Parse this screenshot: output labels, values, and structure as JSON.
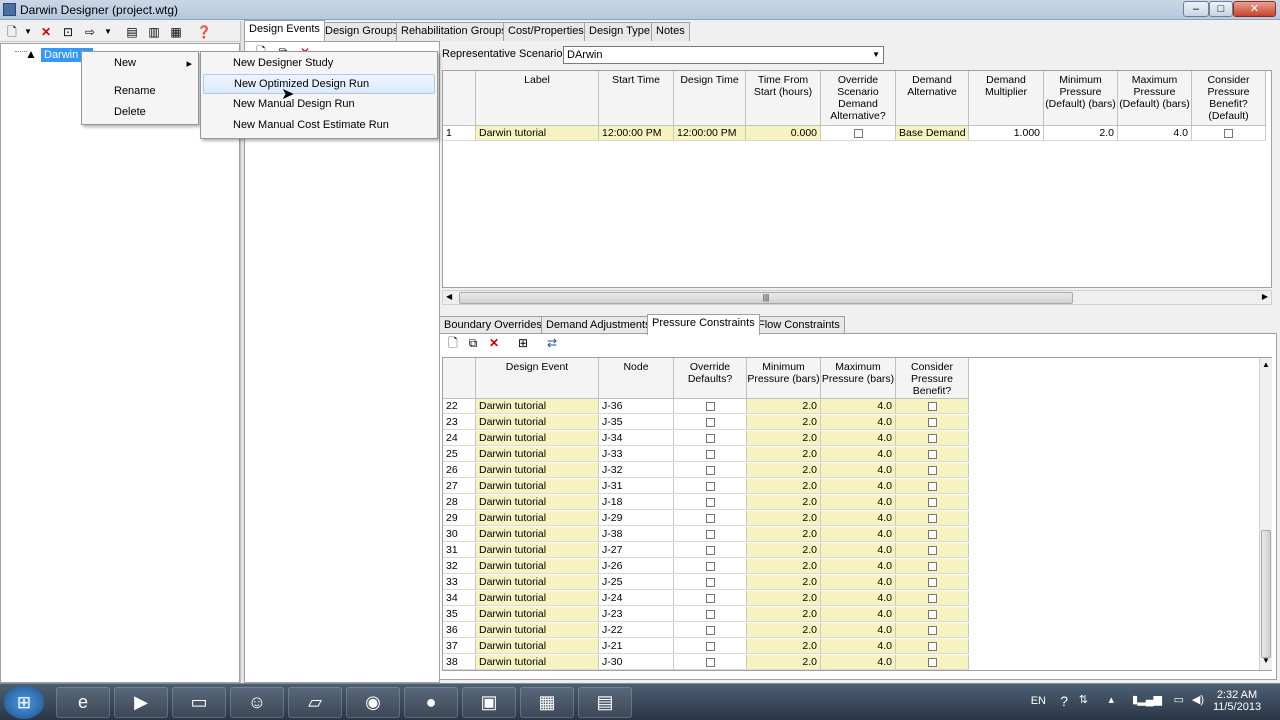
{
  "window": {
    "title": "Darwin Designer (project.wtg)",
    "buttons": {
      "minimize": "–",
      "maximize": "□",
      "close": "✕"
    }
  },
  "tree": {
    "node_label": "Darwin tu"
  },
  "context_menu": {
    "items": [
      "New",
      "Rename",
      "Delete"
    ],
    "submenu": [
      "New Designer Study",
      "New Optimized Design Run",
      "New Manual Design Run",
      "New Manual Cost Estimate Run"
    ],
    "arrow": "▸"
  },
  "top_tabs": [
    "Design Events",
    "Design Groups",
    "Rehabilitation Groups",
    "Cost/Properties",
    "Design Type",
    "Notes"
  ],
  "scenario": {
    "label": "Representative Scenario:",
    "value": "DArwin"
  },
  "grid1": {
    "headers": [
      "Label",
      "Start Time",
      "Design Time",
      "Time From Start (hours)",
      "Override Scenario Demand Alternative?",
      "Demand Alternative",
      "Demand Multiplier",
      "Minimum Pressure (Default) (bars)",
      "Maximum Pressure (Default) (bars)",
      "Consider Pressure Benefit? (Default)"
    ],
    "row": {
      "num": "1",
      "label": "Darwin tutorial",
      "start": "12:00:00 PM",
      "design": "12:00:00 PM",
      "tfs": "0.000",
      "demand_alt": "Base Demand",
      "mult": "1.000",
      "minp": "2.0",
      "maxp": "4.0"
    }
  },
  "bottom_tabs": [
    "Boundary Overrides",
    "Demand Adjustments",
    "Pressure Constraints",
    "Flow Constraints"
  ],
  "grid2": {
    "headers": [
      "Design Event",
      "Node",
      "Override Defaults?",
      "Minimum Pressure (bars)",
      "Maximum Pressure (bars)",
      "Consider Pressure Benefit?"
    ],
    "rows": [
      [
        "22",
        "Darwin tutorial",
        "J-36",
        "2.0",
        "4.0"
      ],
      [
        "23",
        "Darwin tutorial",
        "J-35",
        "2.0",
        "4.0"
      ],
      [
        "24",
        "Darwin tutorial",
        "J-34",
        "2.0",
        "4.0"
      ],
      [
        "25",
        "Darwin tutorial",
        "J-33",
        "2.0",
        "4.0"
      ],
      [
        "26",
        "Darwin tutorial",
        "J-32",
        "2.0",
        "4.0"
      ],
      [
        "27",
        "Darwin tutorial",
        "J-31",
        "2.0",
        "4.0"
      ],
      [
        "28",
        "Darwin tutorial",
        "J-18",
        "2.0",
        "4.0"
      ],
      [
        "29",
        "Darwin tutorial",
        "J-29",
        "2.0",
        "4.0"
      ],
      [
        "30",
        "Darwin tutorial",
        "J-38",
        "2.0",
        "4.0"
      ],
      [
        "31",
        "Darwin tutorial",
        "J-27",
        "2.0",
        "4.0"
      ],
      [
        "32",
        "Darwin tutorial",
        "J-26",
        "2.0",
        "4.0"
      ],
      [
        "33",
        "Darwin tutorial",
        "J-25",
        "2.0",
        "4.0"
      ],
      [
        "34",
        "Darwin tutorial",
        "J-24",
        "2.0",
        "4.0"
      ],
      [
        "35",
        "Darwin tutorial",
        "J-23",
        "2.0",
        "4.0"
      ],
      [
        "36",
        "Darwin tutorial",
        "J-22",
        "2.0",
        "4.0"
      ],
      [
        "37",
        "Darwin tutorial",
        "J-21",
        "2.0",
        "4.0"
      ],
      [
        "38",
        "Darwin tutorial",
        "J-30",
        "2.0",
        "4.0"
      ]
    ]
  },
  "taskbar": {
    "language": "EN",
    "time": "2:32 AM",
    "date": "11/5/2013"
  }
}
